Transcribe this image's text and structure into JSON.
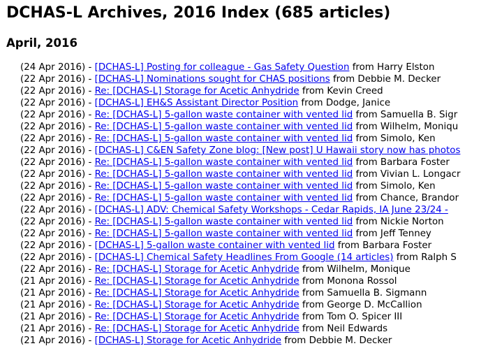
{
  "page": {
    "title": "DCHAS-L Archives, 2016 Index (685 articles)",
    "month_heading": "April, 2016"
  },
  "colors": {
    "link": "#0000ee",
    "text": "#000000",
    "background": "#ffffff"
  },
  "articles": [
    {
      "date": "(24 Apr 2016) - ",
      "subject": "[DCHAS-L] Posting for colleague - Gas Safety Question",
      "from_label": " from ",
      "author": "Harry Elston"
    },
    {
      "date": "(22 Apr 2016) - ",
      "subject": "[DCHAS-L] Nominations sought for CHAS positions",
      "from_label": " from ",
      "author": "Debbie M. Decker"
    },
    {
      "date": "(22 Apr 2016) - ",
      "subject": "Re: [DCHAS-L] Storage for Acetic Anhydride",
      "from_label": " from ",
      "author": "Kevin Creed"
    },
    {
      "date": "(22 Apr 2016) - ",
      "subject": "[DCHAS-L] EH&S Assistant Director Position",
      "from_label": " from ",
      "author": "Dodge, Janice"
    },
    {
      "date": "(22 Apr 2016) - ",
      "subject": "Re: [DCHAS-L] 5-gallon waste container with vented lid",
      "from_label": " from ",
      "author": "Samuella B. Sigr"
    },
    {
      "date": "(22 Apr 2016) - ",
      "subject": "Re: [DCHAS-L] 5-gallon waste container with vented lid",
      "from_label": " from ",
      "author": "Wilhelm, Moniqu"
    },
    {
      "date": "(22 Apr 2016) - ",
      "subject": "Re: [DCHAS-L] 5-gallon waste container with vented lid",
      "from_label": " from ",
      "author": "Simolo, Ken"
    },
    {
      "date": "(22 Apr 2016) - ",
      "subject": "[DCHAS-L] C&EN Safety Zone blog: [New post] U Hawaii story now has photos",
      "from_label": "",
      "author": ""
    },
    {
      "date": "(22 Apr 2016) - ",
      "subject": "Re: [DCHAS-L] 5-gallon waste container with vented lid",
      "from_label": " from ",
      "author": "Barbara Foster"
    },
    {
      "date": "(22 Apr 2016) - ",
      "subject": "Re: [DCHAS-L] 5-gallon waste container with vented lid",
      "from_label": " from ",
      "author": "Vivian L. Longacr"
    },
    {
      "date": "(22 Apr 2016) - ",
      "subject": "Re: [DCHAS-L] 5-gallon waste container with vented lid",
      "from_label": " from ",
      "author": "Simolo, Ken"
    },
    {
      "date": "(22 Apr 2016) - ",
      "subject": "Re: [DCHAS-L] 5-gallon waste container with vented lid",
      "from_label": " from ",
      "author": "Chance, Brandor"
    },
    {
      "date": "(22 Apr 2016) - ",
      "subject": "[DCHAS-L] ADV: Chemical Safety Workshops - Cedar Rapids, IA June 23/24 -",
      "from_label": "",
      "author": ""
    },
    {
      "date": "(22 Apr 2016) - ",
      "subject": "Re: [DCHAS-L] 5-gallon waste container with vented lid",
      "from_label": " from ",
      "author": "Nickie Norton"
    },
    {
      "date": "(22 Apr 2016) - ",
      "subject": "Re: [DCHAS-L] 5-gallon waste container with vented lid",
      "from_label": " from ",
      "author": "Jeff Tenney"
    },
    {
      "date": "(22 Apr 2016) - ",
      "subject": "[DCHAS-L] 5-gallon waste container with vented lid",
      "from_label": " from ",
      "author": "Barbara Foster"
    },
    {
      "date": "(22 Apr 2016) - ",
      "subject": "[DCHAS-L] Chemical Safety Headlines From Google (14 articles)",
      "from_label": " from ",
      "author": "Ralph S"
    },
    {
      "date": "(22 Apr 2016) - ",
      "subject": "Re: [DCHAS-L] Storage for Acetic Anhydride",
      "from_label": " from ",
      "author": "Wilhelm, Monique"
    },
    {
      "date": "(21 Apr 2016) - ",
      "subject": "Re: [DCHAS-L] Storage for Acetic Anhydride",
      "from_label": " from ",
      "author": "Monona Rossol"
    },
    {
      "date": "(21 Apr 2016) - ",
      "subject": "Re: [DCHAS-L] Storage for Acetic Anhydride",
      "from_label": " from ",
      "author": "Samuella B. Sigmann"
    },
    {
      "date": "(21 Apr 2016) - ",
      "subject": "Re: [DCHAS-L] Storage for Acetic Anhydride",
      "from_label": " from ",
      "author": "George D. McCallion"
    },
    {
      "date": "(21 Apr 2016) - ",
      "subject": "Re: [DCHAS-L] Storage for Acetic Anhydride",
      "from_label": " from ",
      "author": "Tom O. Spicer III"
    },
    {
      "date": "(21 Apr 2016) - ",
      "subject": "Re: [DCHAS-L] Storage for Acetic Anhydride",
      "from_label": " from ",
      "author": "Neil Edwards"
    },
    {
      "date": "(21 Apr 2016) - ",
      "subject": "[DCHAS-L] Storage for Acetic Anhydride",
      "from_label": " from ",
      "author": "Debbie M. Decker"
    }
  ]
}
